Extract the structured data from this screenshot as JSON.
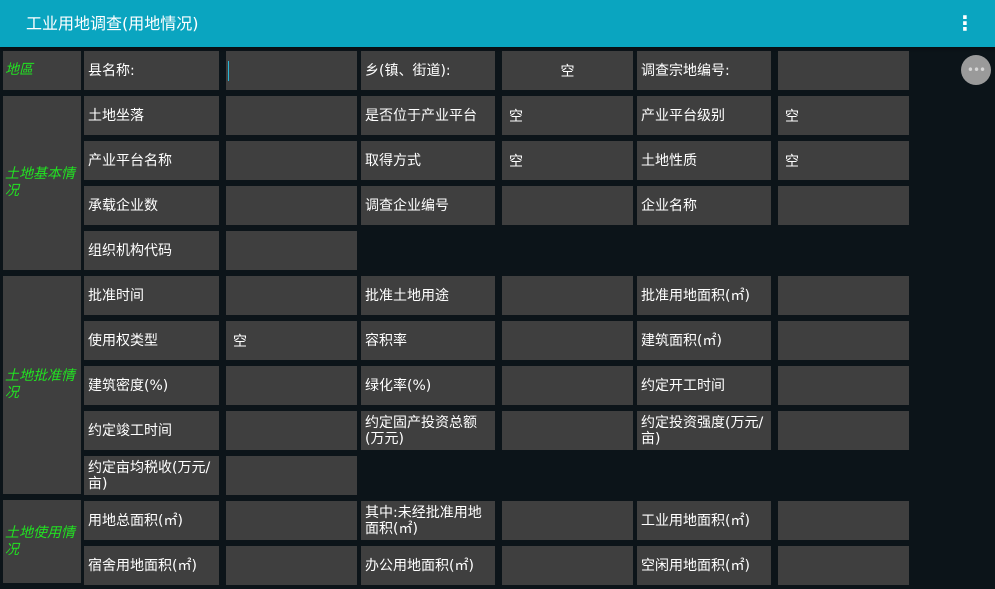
{
  "app_bar": {
    "title": "工业用地调查(用地情况)",
    "more_icon": "⋮"
  },
  "sections": {
    "area": "地區",
    "basic": "土地基本情况",
    "approval": "土地批准情况",
    "usage": "土地使用情况"
  },
  "fields": {
    "county_name": {
      "label": "县名称:",
      "value": ""
    },
    "township": {
      "label": "乡(镇、街道):",
      "value": "空"
    },
    "parcel_no": {
      "label": "调查宗地编号:",
      "value": ""
    },
    "location": {
      "label": "土地坐落",
      "value": ""
    },
    "on_platform": {
      "label": "是否位于产业平台",
      "value": "空"
    },
    "platform_level": {
      "label": "产业平台级别",
      "value": "空"
    },
    "platform_name": {
      "label": "产业平台名称",
      "value": ""
    },
    "acquire_method": {
      "label": "取得方式",
      "value": "空"
    },
    "land_nature": {
      "label": "土地性质",
      "value": "空"
    },
    "enterprise_count": {
      "label": "承载企业数",
      "value": ""
    },
    "enterprise_no": {
      "label": "调查企业编号",
      "value": ""
    },
    "enterprise_name": {
      "label": "企业名称",
      "value": ""
    },
    "org_code": {
      "label": "组织机构代码",
      "value": ""
    },
    "approval_time": {
      "label": "批准时间",
      "value": ""
    },
    "approved_use": {
      "label": "批准土地用途",
      "value": ""
    },
    "approved_area": {
      "label": "批准用地面积(㎡)",
      "value": ""
    },
    "right_type": {
      "label": "使用权类型",
      "value": "空"
    },
    "plot_ratio": {
      "label": "容积率",
      "value": ""
    },
    "building_area": {
      "label": "建筑面积(㎡)",
      "value": ""
    },
    "building_density": {
      "label": "建筑密度(%)",
      "value": ""
    },
    "green_rate": {
      "label": "绿化率(%)",
      "value": ""
    },
    "agreed_start": {
      "label": "约定开工时间",
      "value": ""
    },
    "agreed_finish": {
      "label": "约定竣工时间",
      "value": ""
    },
    "agreed_investment": {
      "label": "约定固产投资总额(万元)",
      "value": ""
    },
    "agreed_intensity": {
      "label": "约定投资强度(万元/亩)",
      "value": ""
    },
    "agreed_tax": {
      "label": "约定亩均税收(万元/亩)",
      "value": ""
    },
    "total_area": {
      "label": "用地总面积(㎡)",
      "value": ""
    },
    "unapproved_area": {
      "label": "其中:未经批准用地面积(㎡)",
      "value": ""
    },
    "industrial_area": {
      "label": "工业用地面积(㎡)",
      "value": ""
    },
    "dorm_area": {
      "label": "宿舍用地面积(㎡)",
      "value": ""
    },
    "office_area": {
      "label": "办公用地面积(㎡)",
      "value": ""
    },
    "idle_area": {
      "label": "空闲用地面积(㎡)",
      "value": ""
    }
  },
  "fab_icon": "•••"
}
